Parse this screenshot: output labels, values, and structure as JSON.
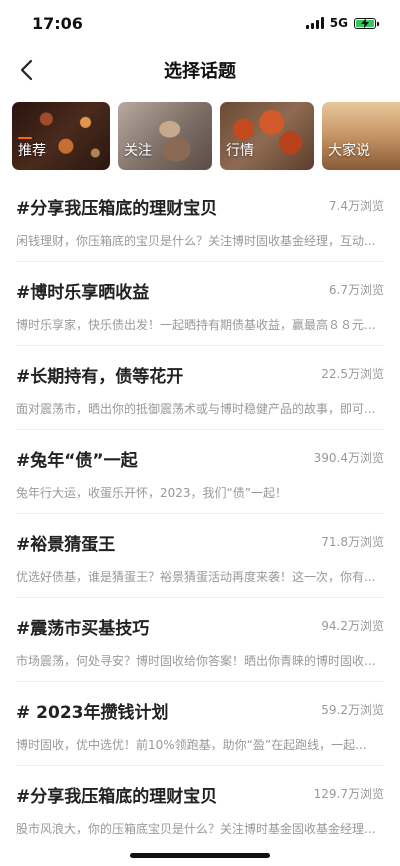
{
  "status_bar": {
    "time": "17:06",
    "network": "5G"
  },
  "header": {
    "title": "选择话题"
  },
  "categories": [
    {
      "label": "推荐",
      "active": true
    },
    {
      "label": "关注",
      "active": false
    },
    {
      "label": "行情",
      "active": false
    },
    {
      "label": "大家说",
      "active": false
    }
  ],
  "topics": [
    {
      "title": "#分享我压箱底的理财宝贝",
      "views": "7.4万浏览",
      "desc": "闲钱理财，你压箱底的宝贝是什么？关注博时固收基金经理，互动..."
    },
    {
      "title": "#博时乐享晒收益",
      "views": "6.7万浏览",
      "desc": "博时乐享家，快乐债出发！一起晒持有期债基收益，赢最高８８元..."
    },
    {
      "title": "#长期持有，债等花开",
      "views": "22.5万浏览",
      "desc": "面对震荡市，晒出你的抵御震荡术或与博时稳健产品的故事，即可..."
    },
    {
      "title": "#兔年“债”一起",
      "views": "390.4万浏览",
      "desc": "兔年行大运，收蛋乐开怀，2023，我们“债”一起！"
    },
    {
      "title": "#裕景猜蛋王",
      "views": "71.8万浏览",
      "desc": "优选好债基，谁是猜蛋王？裕景猜蛋活动再度来袭！这一次，你有..."
    },
    {
      "title": "#震荡市买基技巧",
      "views": "94.2万浏览",
      "desc": "市场震荡，何处寻安？博时固收给你答案！晒出你青睐的博时固收..."
    },
    {
      "title": "# 2023年攒钱计划",
      "views": "59.2万浏览",
      "desc": "博时固收，优中选优！前10%领跑基，助你“盈”在起跑线，一起..."
    },
    {
      "title": "#分享我压箱底的理财宝贝",
      "views": "129.7万浏览",
      "desc": "股市风浪大，你的压箱底宝贝是什么？关注博时基金固收基金经理..."
    }
  ],
  "colors": {
    "accent": "#ff6a00",
    "battery": "#34c759"
  }
}
